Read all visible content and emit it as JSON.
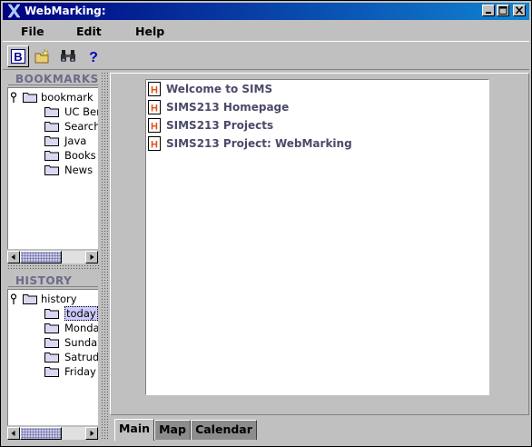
{
  "window": {
    "title": "WebMarking:"
  },
  "menu": [
    "File",
    "Edit",
    "Help"
  ],
  "toolbar": {
    "bookmark_button_letter": "B",
    "help_button_glyph": "?"
  },
  "bookmarks_panel": {
    "header": "BOOKMARKS",
    "root": "bookmark",
    "items": [
      "UC Berkeley",
      "Search",
      "Java",
      "Books",
      "News"
    ]
  },
  "history_panel": {
    "header": "HISTORY",
    "root": "history",
    "items": [
      "today",
      "Monday",
      "Sunday",
      "Satruday",
      "Friday"
    ]
  },
  "links": [
    "Welcome to SIMS",
    "SIMS213 Homepage",
    "SIMS213 Projects",
    "SIMS213 Project: WebMarking"
  ],
  "tabs": [
    "Main",
    "Map",
    "Calendar"
  ],
  "colors": {
    "title_start": "#000080",
    "title_end": "#1084d0",
    "link_text": "#4a4a6a",
    "panel_header": "#6b6b8a",
    "html_icon": "#e05010"
  }
}
